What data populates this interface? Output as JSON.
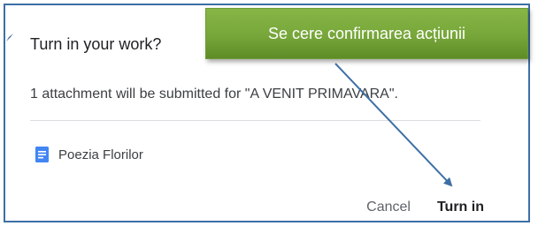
{
  "dialog": {
    "title": "Turn in your work?",
    "message": "1 attachment will be submitted for \"A VENIT PRIMAVARA\".",
    "attachment": {
      "name": "Poezia Florilor",
      "icon": "google-docs-icon"
    },
    "cancel_label": "Cancel",
    "turn_in_label": "Turn in"
  },
  "callout": {
    "text": "Se cere confirmarea acțiunii"
  },
  "colors": {
    "dialog_border": "#3d6fa5",
    "doc_icon": "#4285f4",
    "callout_green": "#77a63a",
    "arrow": "#3d6fa5",
    "divider": "#dadce0"
  }
}
